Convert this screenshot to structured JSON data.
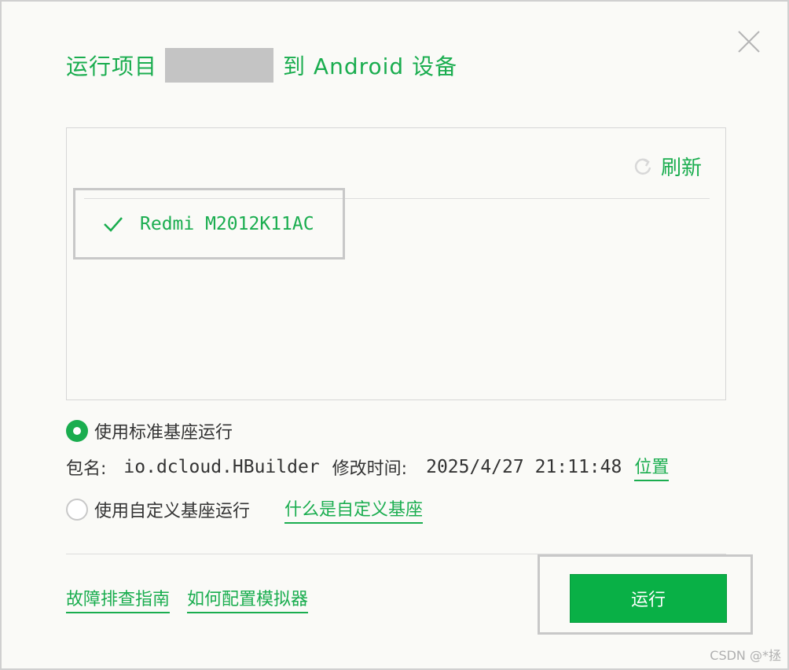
{
  "dialog": {
    "title_prefix": "运行项目",
    "title_suffix": "到 Android 设备"
  },
  "device_panel": {
    "refresh_label": "刷新",
    "devices": [
      {
        "name": "Redmi M2012K11AC",
        "selected": true
      }
    ]
  },
  "base_options": {
    "standard_label": "使用标准基座运行",
    "standard_selected": true,
    "package_label": "包名:",
    "package_value": "io.dcloud.HBuilder",
    "modified_label": "修改时间:",
    "modified_value": "2025/4/27 21:11:48",
    "location_link": "位置",
    "custom_label": "使用自定义基座运行",
    "custom_selected": false,
    "custom_help_link": "什么是自定义基座"
  },
  "footer": {
    "troubleshoot_link": "故障排查指南",
    "emulator_link": "如何配置模拟器",
    "run_button": "运行"
  },
  "watermark": "CSDN @*拯",
  "colors": {
    "accent": "#1aad4f",
    "run_button": "#09b046",
    "mask": "#c4c4c4"
  }
}
